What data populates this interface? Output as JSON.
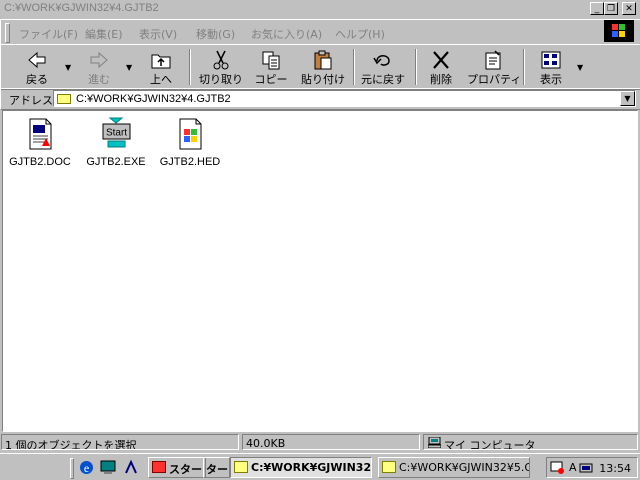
{
  "window": {
    "title": "C:¥WORK¥GJWIN32¥4.GJTB2"
  },
  "window_controls": {
    "minimize": "_",
    "maximize": "❐",
    "close": "✕"
  },
  "menu": [
    "ファイル(F)",
    "編集(E)",
    "表示(V)",
    "移動(G)",
    "お気に入り(A)",
    "ヘルプ(H)"
  ],
  "toolbar": {
    "back": "戻る",
    "forward": "進む",
    "up": "上へ",
    "cut": "切り取り",
    "copy": "コピー",
    "paste": "貼り付け",
    "undo": "元に戻す",
    "delete": "削除",
    "properties": "プロパティ",
    "view": "表示"
  },
  "address": {
    "label": "アドレス",
    "value": "C:¥WORK¥GJWIN32¥4.GJTB2"
  },
  "files": [
    {
      "name": "GJTB2.DOC",
      "icon": "doc-icon"
    },
    {
      "name": "GJTB2.EXE",
      "icon": "start-exe-icon",
      "icon_text": "Start"
    },
    {
      "name": "GJTB2.HED",
      "icon": "windows-file-icon"
    }
  ],
  "status": {
    "selection": "1 個のオブジェクトを選択",
    "size": "40.0KB",
    "location": "マイ コンピュータ"
  },
  "taskbar": {
    "start_label": "スタート",
    "start_overlap": "タート",
    "tasks": [
      "C:¥WORK¥GJWIN32...",
      "C:¥WORK¥GJWIN32¥5.G..."
    ],
    "tray_ime": "A",
    "clock": "13:54"
  }
}
